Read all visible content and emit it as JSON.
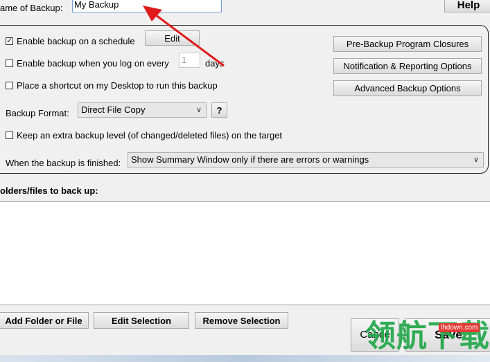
{
  "header": {
    "name_label": "ame of Backup:",
    "name_value": "My Backup",
    "help_label": "Help"
  },
  "options": {
    "schedule_label": "Enable backup on a schedule",
    "schedule_checked": true,
    "edit_label": "Edit",
    "logon_label": "Enable backup when you log on every",
    "logon_days_value": "1",
    "days_label": "days",
    "logon_checked": false,
    "shortcut_label": "Place a shortcut on my Desktop to run this backup",
    "shortcut_checked": false,
    "format_label": "Backup Format:",
    "format_value": "Direct File Copy",
    "format_help": "?",
    "extra_level_label": "Keep an extra backup level (of changed/deleted files) on the target",
    "extra_level_checked": false,
    "finished_label": "When the backup is finished:",
    "finished_value": "Show Summary Window only if there are errors or warnings"
  },
  "side_buttons": {
    "closures": "Pre-Backup Program Closures",
    "notifications": "Notification & Reporting Options",
    "advanced": "Advanced Backup Options"
  },
  "files": {
    "title": "olders/files to back up:"
  },
  "footer": {
    "add": "Add Folder or File",
    "edit": "Edit Selection",
    "remove": "Remove Selection",
    "cancel": "Cance",
    "save": "Save"
  },
  "watermark": {
    "logo_text": "领航下载",
    "site": "lhdown.com"
  },
  "annotation": {
    "arrow_color": "#e01b1b"
  }
}
